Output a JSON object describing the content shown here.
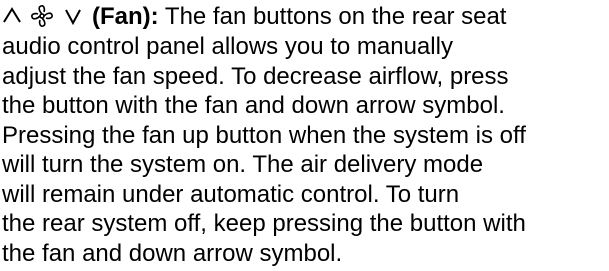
{
  "paragraph": {
    "term": "(Fan):",
    "lead_text": "The fan buttons on the rear seat",
    "lines": [
      "audio control panel allows you to manually",
      "adjust the fan speed. To decrease airflow, press",
      "the button with the fan and down arrow symbol.",
      "Pressing the fan up button when the system is off",
      "will turn the system on. The air delivery mode",
      "will remain under automatic control. To turn",
      "the rear system off, keep pressing the button with",
      "the fan and down arrow symbol."
    ]
  },
  "icons": [
    "up-arrow-icon",
    "fan-icon",
    "down-arrow-icon"
  ],
  "colors": {
    "text": "#000000",
    "background": "#ffffff"
  }
}
